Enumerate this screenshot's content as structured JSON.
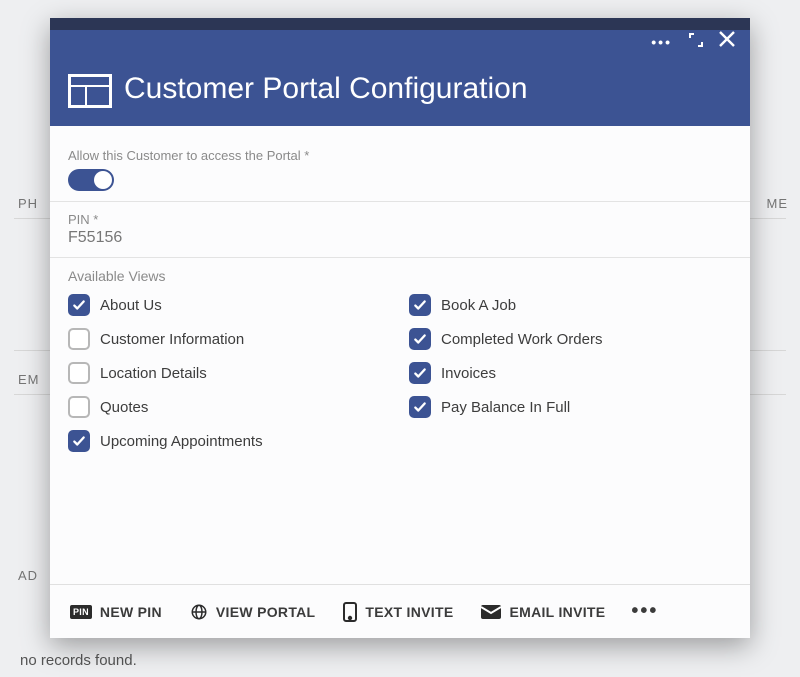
{
  "background": {
    "labels": {
      "ph": "PH",
      "me": "ME",
      "em": "EM",
      "ad": "AD"
    },
    "no_records": "no records found."
  },
  "dialog": {
    "title": "Customer Portal Configuration",
    "access": {
      "label": "Allow this Customer to access the Portal *",
      "enabled": true
    },
    "pin": {
      "label": "PIN *",
      "value": "F55156"
    },
    "views": {
      "label": "Available Views",
      "items": [
        {
          "label": "About Us",
          "checked": true
        },
        {
          "label": "Book A Job",
          "checked": true
        },
        {
          "label": "Customer Information",
          "checked": false
        },
        {
          "label": "Completed Work Orders",
          "checked": true
        },
        {
          "label": "Location Details",
          "checked": false
        },
        {
          "label": "Invoices",
          "checked": true
        },
        {
          "label": "Quotes",
          "checked": false
        },
        {
          "label": "Pay Balance In Full",
          "checked": true
        },
        {
          "label": "Upcoming Appointments",
          "checked": true
        }
      ]
    },
    "footer": {
      "new_pin": "NEW PIN",
      "view_portal": "VIEW PORTAL",
      "text_invite": "TEXT INVITE",
      "email_invite": "EMAIL INVITE"
    }
  }
}
